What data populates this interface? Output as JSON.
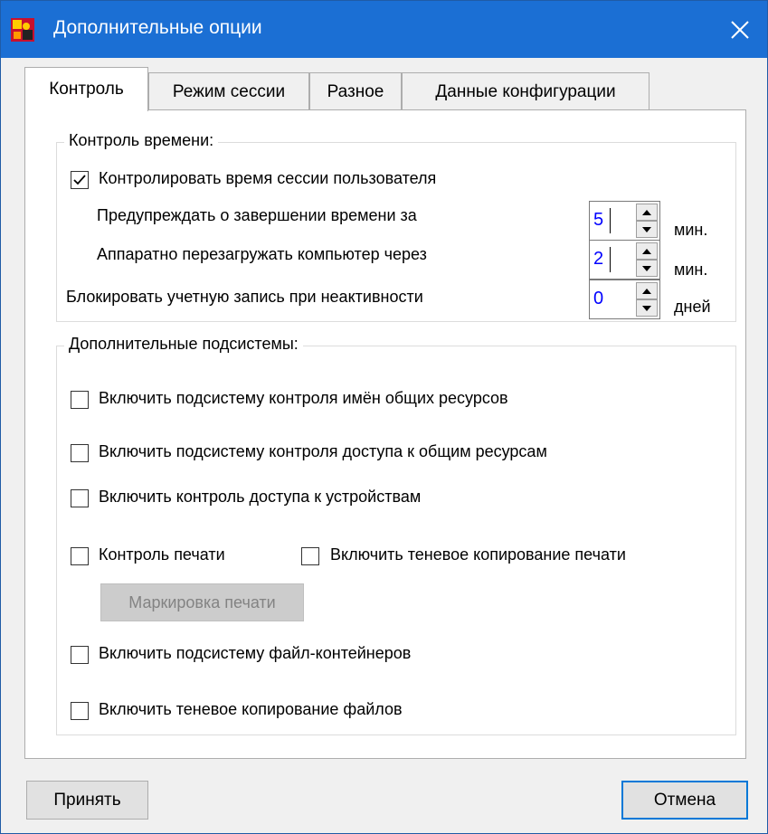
{
  "window": {
    "title": "Дополнительные опции"
  },
  "tabs": [
    {
      "label": "Контроль",
      "active": true
    },
    {
      "label": "Режим сессии",
      "active": false
    },
    {
      "label": "Разное",
      "active": false
    },
    {
      "label": "Данные конфигурации",
      "active": false
    }
  ],
  "time_control": {
    "legend": "Контроль времени:",
    "session_checkbox": {
      "label": "Контролировать время сессии пользователя",
      "checked": true
    },
    "warn_label": "Предупреждать о завершении времени за",
    "warn_value": "5",
    "warn_unit": "мин.",
    "reboot_label": "Аппаратно перезагружать компьютер через",
    "reboot_value": "2",
    "reboot_unit": "мин.",
    "lock_label": "Блокировать учетную запись при неактивности",
    "lock_value": "0",
    "lock_unit": "дней"
  },
  "subsystems": {
    "legend": "Дополнительные подсистемы:",
    "share_names": {
      "label": "Включить подсистему контроля имён общих ресурсов",
      "checked": false
    },
    "share_access": {
      "label": "Включить подсистему контроля доступа к общим ресурсам",
      "checked": false
    },
    "device_access": {
      "label": "Включить контроль доступа к устройствам",
      "checked": false
    },
    "print_control": {
      "label": "Контроль печати",
      "checked": false
    },
    "print_shadow": {
      "label": "Включить теневое копирование печати",
      "checked": false
    },
    "print_marking_button": "Маркировка печати",
    "file_containers": {
      "label": "Включить подсистему файл-контейнеров",
      "checked": false
    },
    "file_shadow": {
      "label": "Включить теневое копирование файлов",
      "checked": false
    }
  },
  "buttons": {
    "accept": "Принять",
    "cancel": "Отмена"
  },
  "colors": {
    "titlebar": "#1b6fd4",
    "spin_value_text": "#0000ff",
    "default_button_border": "#0078d7"
  }
}
